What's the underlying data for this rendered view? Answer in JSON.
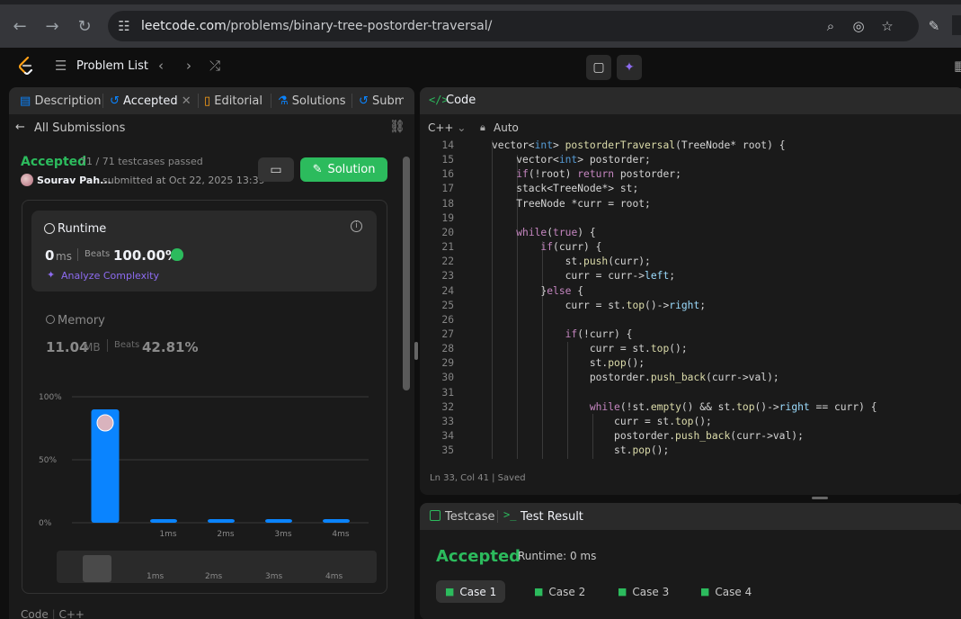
{
  "browser": {
    "url_host": "leetcode.com",
    "url_path": "/problems/binary-tree-postorder-traversal/"
  },
  "header": {
    "problem_list": "Problem List"
  },
  "left_tabs": [
    {
      "label": "Description"
    },
    {
      "label": "Accepted"
    },
    {
      "label": "Editorial"
    },
    {
      "label": "Solutions"
    },
    {
      "label": "Subm"
    }
  ],
  "submission": {
    "back_label": "All Submissions",
    "status": "Accepted",
    "testcases": "71 / 71 testcases passed",
    "author": "Sourav Pah...",
    "submitted": "submitted at Oct 22, 2025 13:39",
    "solution_button": "Solution"
  },
  "runtime": {
    "label": "Runtime",
    "value": "0",
    "unit": "ms",
    "beats_label": "Beats",
    "beats": "100.00%",
    "analyze": "Analyze Complexity"
  },
  "memory": {
    "label": "Memory",
    "value": "11.04",
    "unit": "MB",
    "beats_label": "Beats",
    "beats": "42.81%"
  },
  "chart_data": {
    "type": "bar",
    "categories": [
      "0ms",
      "1ms",
      "2ms",
      "3ms",
      "4ms"
    ],
    "x_tick_labels": [
      "",
      "1ms",
      "2ms",
      "3ms",
      "4ms"
    ],
    "values": [
      90,
      2,
      2,
      2,
      2
    ],
    "y_ticks": [
      "100%",
      "50%",
      "0%"
    ],
    "ylim": [
      0,
      100
    ],
    "bar_color": "#0a84ff",
    "grid": true
  },
  "scroller_labels": [
    "1ms",
    "2ms",
    "3ms",
    "4ms"
  ],
  "left_bottom": {
    "label": "Code",
    "lang": "C++"
  },
  "code_panel": {
    "title": "Code",
    "language": "C++",
    "mode": "Auto",
    "status": "Ln 33, Col 41   |   Saved"
  },
  "code_lines": [
    {
      "n": "14",
      "t": "vector<int> postorderTraversal(TreeNode* root) {"
    },
    {
      "n": "15",
      "t": "    vector<int> postorder;"
    },
    {
      "n": "16",
      "t": "    if(!root) return postorder;"
    },
    {
      "n": "17",
      "t": "    stack<TreeNode*> st;"
    },
    {
      "n": "18",
      "t": "    TreeNode *curr = root;"
    },
    {
      "n": "19",
      "t": ""
    },
    {
      "n": "20",
      "t": "    while(true) {"
    },
    {
      "n": "21",
      "t": "        if(curr) {"
    },
    {
      "n": "22",
      "t": "            st.push(curr);"
    },
    {
      "n": "23",
      "t": "            curr = curr->left;"
    },
    {
      "n": "24",
      "t": "        }else {"
    },
    {
      "n": "25",
      "t": "            curr = st.top()->right;"
    },
    {
      "n": "26",
      "t": ""
    },
    {
      "n": "27",
      "t": "            if(!curr) {"
    },
    {
      "n": "28",
      "t": "                curr = st.top();"
    },
    {
      "n": "29",
      "t": "                st.pop();"
    },
    {
      "n": "30",
      "t": "                postorder.push_back(curr->val);"
    },
    {
      "n": "31",
      "t": ""
    },
    {
      "n": "32",
      "t": "                while(!st.empty() && st.top()->right == curr) {"
    },
    {
      "n": "33",
      "t": "                    curr = st.top();"
    },
    {
      "n": "34",
      "t": "                    postorder.push_back(curr->val);"
    },
    {
      "n": "35",
      "t": "                    st.pop();"
    }
  ],
  "test_panel": {
    "testcase_tab": "Testcase",
    "result_tab": "Test Result",
    "status": "Accepted",
    "runtime": "Runtime: 0 ms",
    "cases": [
      "Case 1",
      "Case 2",
      "Case 3",
      "Case 4"
    ]
  },
  "colors": {
    "accent_green": "#2cbb5d",
    "bar_blue": "#0a84ff",
    "analyze_purple": "#8d6bf0"
  }
}
